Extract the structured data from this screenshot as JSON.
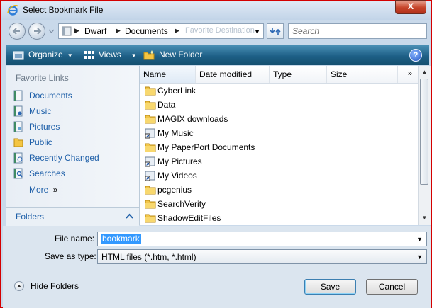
{
  "window": {
    "title": "Select Bookmark File",
    "close_glyph": "X"
  },
  "address": {
    "crumbs": [
      "Dwarf",
      "Documents"
    ],
    "ghost_text": "Favorite Destination",
    "search_placeholder": "Search"
  },
  "toolbar": {
    "organize": "Organize",
    "views": "Views",
    "new_folder": "New Folder",
    "help_glyph": "?"
  },
  "nav": {
    "header": "Favorite Links",
    "links": [
      {
        "label": "Documents",
        "icon": "documents-icon"
      },
      {
        "label": "Music",
        "icon": "music-icon"
      },
      {
        "label": "Pictures",
        "icon": "pictures-icon"
      },
      {
        "label": "Public",
        "icon": "public-icon"
      },
      {
        "label": "Recently Changed",
        "icon": "recently-changed-icon"
      },
      {
        "label": "Searches",
        "icon": "searches-icon"
      }
    ],
    "more": "More",
    "more_glyph": "»",
    "folders": "Folders"
  },
  "columns": {
    "name": "Name",
    "date": "Date modified",
    "type": "Type",
    "size": "Size",
    "more_glyph": "»"
  },
  "files": [
    {
      "name": "CyberLink",
      "kind": "folder"
    },
    {
      "name": "Data",
      "kind": "folder"
    },
    {
      "name": "MAGIX downloads",
      "kind": "folder"
    },
    {
      "name": "My Music",
      "kind": "shortcut"
    },
    {
      "name": "My PaperPort Documents",
      "kind": "folder"
    },
    {
      "name": "My Pictures",
      "kind": "shortcut"
    },
    {
      "name": "My Videos",
      "kind": "shortcut"
    },
    {
      "name": "pcgenius",
      "kind": "folder"
    },
    {
      "name": "SearchVerity",
      "kind": "folder"
    },
    {
      "name": "ShadowEditFiles",
      "kind": "folder"
    }
  ],
  "form": {
    "filename_label": "File name:",
    "filename_value": "bookmark",
    "type_label": "Save as type:",
    "type_value": "HTML files (*.htm, *.html)"
  },
  "buttons": {
    "hide_folders": "Hide Folders",
    "save": "Save",
    "cancel": "Cancel"
  }
}
